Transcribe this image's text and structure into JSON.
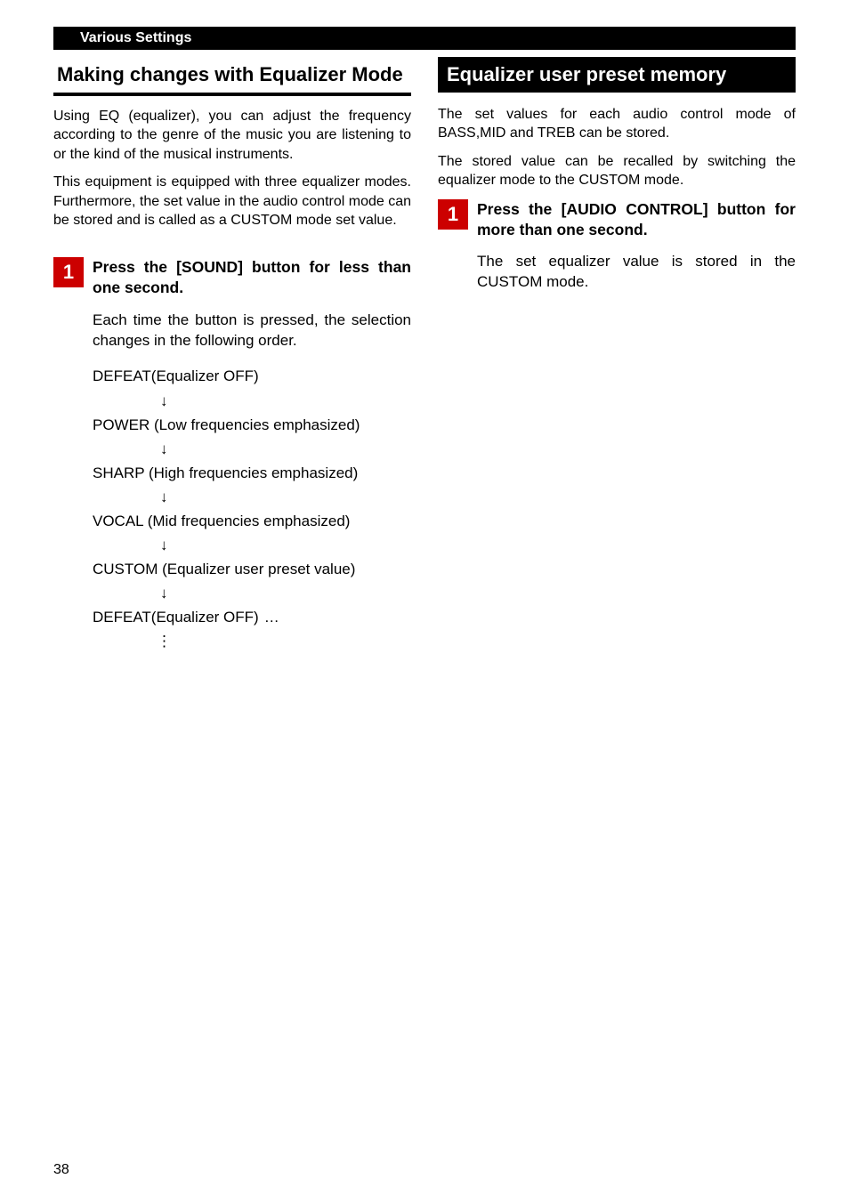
{
  "header": {
    "breadcrumb": "Various Settings"
  },
  "left": {
    "title": "Making changes with Equalizer Mode",
    "para1": "Using EQ (equalizer), you can adjust the frequency according to the genre of the music you are listening to or the kind of the musical instruments.",
    "para2": "This equipment is equipped with three equalizer modes.  Furthermore, the set value in the audio control mode can be stored and is called as a CUSTOM mode set value.",
    "step_num": "1",
    "step_head": "Press the [SOUND] button for less than one second.",
    "step_body": "Each time the button is pressed, the selection changes in the following order.",
    "seq": [
      "DEFEAT(Equalizer OFF)",
      "POWER (Low frequencies emphasized)",
      "SHARP (High frequencies emphasized)",
      "VOCAL (Mid frequencies emphasized)",
      "CUSTOM (Equalizer user preset value)",
      "DEFEAT(Equalizer OFF)"
    ],
    "arrow": "↓",
    "dots_h": "…",
    "dots_v": "⋮"
  },
  "right": {
    "title": "Equalizer user preset memory",
    "para1": "The set values for each audio control mode of BASS,MID and TREB can be stored.",
    "para2": "The stored value can be recalled by switching the equalizer mode to the CUSTOM mode.",
    "step_num": "1",
    "step_head": "Press the [AUDIO CONTROL] button for more than one second.",
    "step_body": "The set equalizer value is stored in the CUSTOM mode."
  },
  "page_number": "38"
}
